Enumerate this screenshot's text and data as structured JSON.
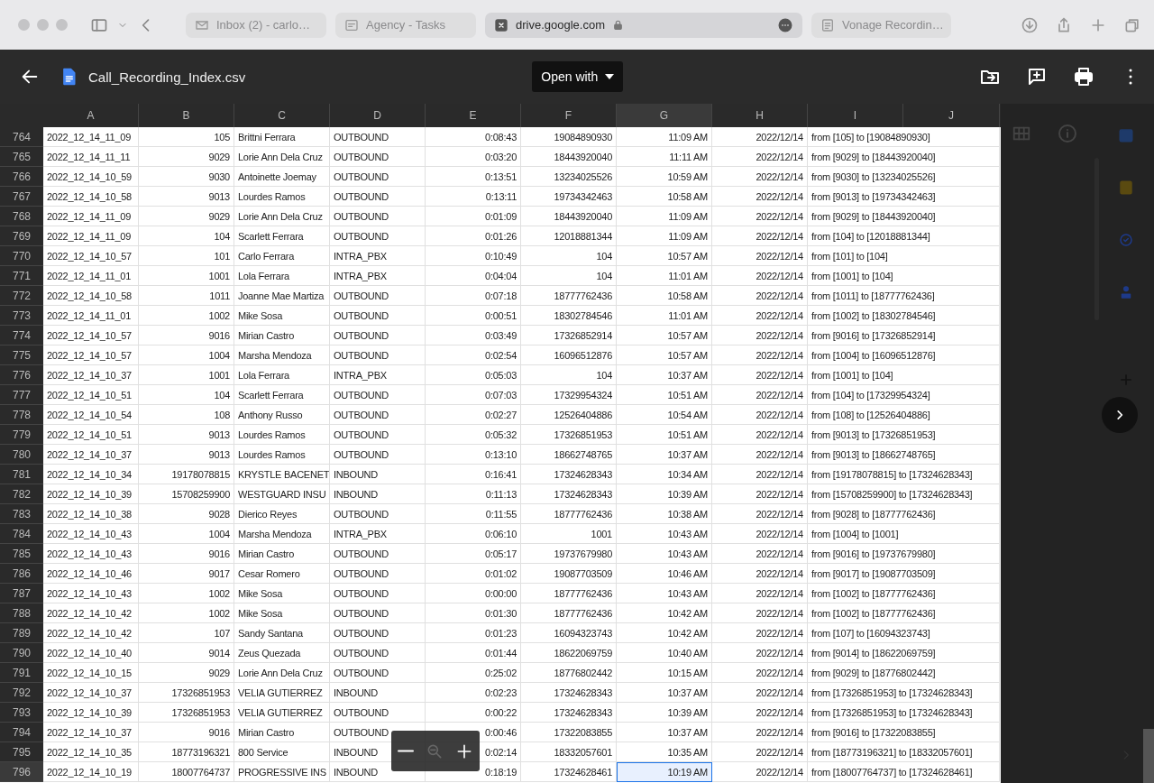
{
  "browser": {
    "tabs": [
      {
        "label": "Inbox (2) - carlo…",
        "selected": false,
        "kind": "mail"
      },
      {
        "label": "Agency - Tasks",
        "selected": false,
        "kind": "tasks"
      },
      {
        "label": "drive.google.com",
        "selected": true,
        "kind": "address"
      },
      {
        "label": "Vonage Recordin…",
        "selected": false,
        "kind": "doc"
      }
    ]
  },
  "viewer": {
    "file_name": "Call_Recording_Index.csv",
    "open_with": "Open with"
  },
  "sheet": {
    "columns": [
      {
        "label": "A",
        "selected": false
      },
      {
        "label": "B",
        "selected": false
      },
      {
        "label": "C",
        "selected": false
      },
      {
        "label": "D",
        "selected": false
      },
      {
        "label": "E",
        "selected": false
      },
      {
        "label": "F",
        "selected": false
      },
      {
        "label": "G",
        "selected": true
      },
      {
        "label": "H",
        "selected": false
      },
      {
        "label": "I",
        "selected": false
      },
      {
        "label": "J",
        "selected": false
      }
    ],
    "rows": [
      {
        "number": "764",
        "selected": false,
        "cells": [
          "2022_12_14_11_09",
          "105",
          "Brittni Ferrara",
          "OUTBOUND",
          "0:08:43",
          "19084890930",
          "11:09 AM",
          "2022/12/14",
          "from [105] to [19084890930]"
        ]
      },
      {
        "number": "765",
        "selected": false,
        "cells": [
          "2022_12_14_11_11",
          "9029",
          "Lorie Ann Dela Cruz",
          "OUTBOUND",
          "0:03:20",
          "18443920040",
          "11:11 AM",
          "2022/12/14",
          "from [9029] to [18443920040]"
        ]
      },
      {
        "number": "766",
        "selected": false,
        "cells": [
          "2022_12_14_10_59",
          "9030",
          "Antoinette Joemay",
          "OUTBOUND",
          "0:13:51",
          "13234025526",
          "10:59 AM",
          "2022/12/14",
          "from [9030] to [13234025526]"
        ]
      },
      {
        "number": "767",
        "selected": false,
        "cells": [
          "2022_12_14_10_58",
          "9013",
          "Lourdes Ramos",
          "OUTBOUND",
          "0:13:11",
          "19734342463",
          "10:58 AM",
          "2022/12/14",
          "from [9013] to [19734342463]"
        ]
      },
      {
        "number": "768",
        "selected": false,
        "cells": [
          "2022_12_14_11_09",
          "9029",
          "Lorie Ann Dela Cruz",
          "OUTBOUND",
          "0:01:09",
          "18443920040",
          "11:09 AM",
          "2022/12/14",
          "from [9029] to [18443920040]"
        ]
      },
      {
        "number": "769",
        "selected": false,
        "cells": [
          "2022_12_14_11_09",
          "104",
          "Scarlett Ferrara",
          "OUTBOUND",
          "0:01:26",
          "12018881344",
          "11:09 AM",
          "2022/12/14",
          "from [104] to [12018881344]"
        ]
      },
      {
        "number": "770",
        "selected": false,
        "cells": [
          "2022_12_14_10_57",
          "101",
          "Carlo Ferrara",
          "INTRA_PBX",
          "0:10:49",
          "104",
          "10:57 AM",
          "2022/12/14",
          "from [101] to [104]"
        ]
      },
      {
        "number": "771",
        "selected": false,
        "cells": [
          "2022_12_14_11_01",
          "1001",
          "Lola Ferrara",
          "INTRA_PBX",
          "0:04:04",
          "104",
          "11:01 AM",
          "2022/12/14",
          "from [1001] to [104]"
        ]
      },
      {
        "number": "772",
        "selected": false,
        "cells": [
          "2022_12_14_10_58",
          "1011",
          "Joanne Mae Martiza",
          "OUTBOUND",
          "0:07:18",
          "18777762436",
          "10:58 AM",
          "2022/12/14",
          "from [1011] to [18777762436]"
        ]
      },
      {
        "number": "773",
        "selected": false,
        "cells": [
          "2022_12_14_11_01",
          "1002",
          "Mike Sosa",
          "OUTBOUND",
          "0:00:51",
          "18302784546",
          "11:01 AM",
          "2022/12/14",
          "from [1002] to [18302784546]"
        ]
      },
      {
        "number": "774",
        "selected": false,
        "cells": [
          "2022_12_14_10_57",
          "9016",
          "Mirian Castro",
          "OUTBOUND",
          "0:03:49",
          "17326852914",
          "10:57 AM",
          "2022/12/14",
          "from [9016] to [17326852914]"
        ]
      },
      {
        "number": "775",
        "selected": false,
        "cells": [
          "2022_12_14_10_57",
          "1004",
          "Marsha Mendoza",
          "OUTBOUND",
          "0:02:54",
          "16096512876",
          "10:57 AM",
          "2022/12/14",
          "from [1004] to [16096512876]"
        ]
      },
      {
        "number": "776",
        "selected": false,
        "cells": [
          "2022_12_14_10_37",
          "1001",
          "Lola Ferrara",
          "INTRA_PBX",
          "0:05:03",
          "104",
          "10:37 AM",
          "2022/12/14",
          "from [1001] to [104]"
        ]
      },
      {
        "number": "777",
        "selected": false,
        "cells": [
          "2022_12_14_10_51",
          "104",
          "Scarlett Ferrara",
          "OUTBOUND",
          "0:07:03",
          "17329954324",
          "10:51 AM",
          "2022/12/14",
          "from [104] to [17329954324]"
        ]
      },
      {
        "number": "778",
        "selected": false,
        "cells": [
          "2022_12_14_10_54",
          "108",
          "Anthony Russo",
          "OUTBOUND",
          "0:02:27",
          "12526404886",
          "10:54 AM",
          "2022/12/14",
          "from [108] to [12526404886]"
        ]
      },
      {
        "number": "779",
        "selected": false,
        "cells": [
          "2022_12_14_10_51",
          "9013",
          "Lourdes Ramos",
          "OUTBOUND",
          "0:05:32",
          "17326851953",
          "10:51 AM",
          "2022/12/14",
          "from [9013] to [17326851953]"
        ]
      },
      {
        "number": "780",
        "selected": false,
        "cells": [
          "2022_12_14_10_37",
          "9013",
          "Lourdes Ramos",
          "OUTBOUND",
          "0:13:10",
          "18662748765",
          "10:37 AM",
          "2022/12/14",
          "from [9013] to [18662748765]"
        ]
      },
      {
        "number": "781",
        "selected": false,
        "cells": [
          "2022_12_14_10_34",
          "19178078815",
          "KRYSTLE BACENET",
          "INBOUND",
          "0:16:41",
          "17324628343",
          "10:34 AM",
          "2022/12/14",
          "from [19178078815] to [17324628343]"
        ]
      },
      {
        "number": "782",
        "selected": false,
        "cells": [
          "2022_12_14_10_39",
          "15708259900",
          "WESTGUARD INSU",
          "INBOUND",
          "0:11:13",
          "17324628343",
          "10:39 AM",
          "2022/12/14",
          "from [15708259900] to [17324628343]"
        ]
      },
      {
        "number": "783",
        "selected": false,
        "cells": [
          "2022_12_14_10_38",
          "9028",
          "Dierico Reyes",
          "OUTBOUND",
          "0:11:55",
          "18777762436",
          "10:38 AM",
          "2022/12/14",
          "from [9028] to [18777762436]"
        ]
      },
      {
        "number": "784",
        "selected": false,
        "cells": [
          "2022_12_14_10_43",
          "1004",
          "Marsha Mendoza",
          "INTRA_PBX",
          "0:06:10",
          "1001",
          "10:43 AM",
          "2022/12/14",
          "from [1004] to [1001]"
        ]
      },
      {
        "number": "785",
        "selected": false,
        "cells": [
          "2022_12_14_10_43",
          "9016",
          "Mirian Castro",
          "OUTBOUND",
          "0:05:17",
          "19737679980",
          "10:43 AM",
          "2022/12/14",
          "from [9016] to [19737679980]"
        ]
      },
      {
        "number": "786",
        "selected": false,
        "cells": [
          "2022_12_14_10_46",
          "9017",
          "Cesar Romero",
          "OUTBOUND",
          "0:01:02",
          "19087703509",
          "10:46 AM",
          "2022/12/14",
          "from [9017] to [19087703509]"
        ]
      },
      {
        "number": "787",
        "selected": false,
        "cells": [
          "2022_12_14_10_43",
          "1002",
          "Mike Sosa",
          "OUTBOUND",
          "0:00:00",
          "18777762436",
          "10:43 AM",
          "2022/12/14",
          "from [1002] to [18777762436]"
        ]
      },
      {
        "number": "788",
        "selected": false,
        "cells": [
          "2022_12_14_10_42",
          "1002",
          "Mike Sosa",
          "OUTBOUND",
          "0:01:30",
          "18777762436",
          "10:42 AM",
          "2022/12/14",
          "from [1002] to [18777762436]"
        ]
      },
      {
        "number": "789",
        "selected": false,
        "cells": [
          "2022_12_14_10_42",
          "107",
          "Sandy Santana",
          "OUTBOUND",
          "0:01:23",
          "16094323743",
          "10:42 AM",
          "2022/12/14",
          "from [107] to [16094323743]"
        ]
      },
      {
        "number": "790",
        "selected": false,
        "cells": [
          "2022_12_14_10_40",
          "9014",
          "Zeus Quezada",
          "OUTBOUND",
          "0:01:44",
          "18622069759",
          "10:40 AM",
          "2022/12/14",
          "from [9014] to [18622069759]"
        ]
      },
      {
        "number": "791",
        "selected": false,
        "cells": [
          "2022_12_14_10_15",
          "9029",
          "Lorie Ann Dela Cruz",
          "OUTBOUND",
          "0:25:02",
          "18776802442",
          "10:15 AM",
          "2022/12/14",
          "from [9029] to [18776802442]"
        ]
      },
      {
        "number": "792",
        "selected": false,
        "cells": [
          "2022_12_14_10_37",
          "17326851953",
          "VELIA GUTIERREZ",
          "INBOUND",
          "0:02:23",
          "17324628343",
          "10:37 AM",
          "2022/12/14",
          "from [17326851953] to [17324628343]"
        ]
      },
      {
        "number": "793",
        "selected": false,
        "cells": [
          "2022_12_14_10_39",
          "17326851953",
          "VELIA GUTIERREZ",
          "OUTBOUND",
          "0:00:22",
          "17324628343",
          "10:39 AM",
          "2022/12/14",
          "from [17326851953] to [17324628343]"
        ]
      },
      {
        "number": "794",
        "selected": false,
        "cells": [
          "2022_12_14_10_37",
          "9016",
          "Mirian Castro",
          "OUTBOUND",
          "0:00:46",
          "17322083855",
          "10:37 AM",
          "2022/12/14",
          "from [9016] to [17322083855]"
        ]
      },
      {
        "number": "795",
        "selected": false,
        "cells": [
          "2022_12_14_10_35",
          "18773196321",
          "800 Service",
          "INBOUND",
          "0:02:14",
          "18332057601",
          "10:35 AM",
          "2022/12/14",
          "from [18773196321] to [18332057601]"
        ]
      },
      {
        "number": "796",
        "selected": true,
        "cells": [
          "2022_12_14_10_19",
          "18007764737",
          "PROGRESSIVE INS",
          "INBOUND",
          "0:18:19",
          "17324628461",
          "10:19 AM",
          "2022/12/14",
          "from [18007764737] to [17324628461]"
        ]
      }
    ]
  }
}
